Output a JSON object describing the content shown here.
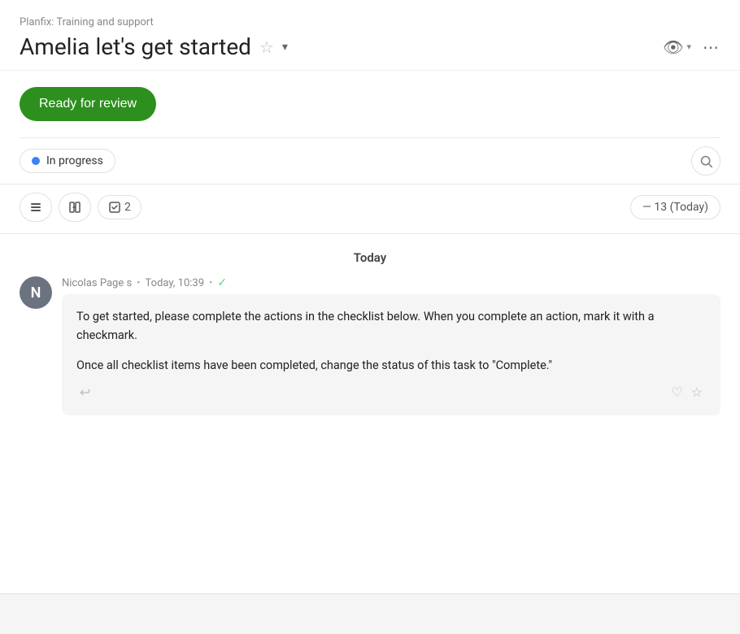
{
  "breadcrumb": "Planfix: Training and support",
  "title": "Amelia let's get started",
  "ready_button": "Ready for review",
  "status": {
    "label": "In progress",
    "dot_color": "#3b82f6"
  },
  "toolbar": {
    "checklist_count": "2",
    "date_info": "— 13 (Today)"
  },
  "feed": {
    "date_header": "Today",
    "messages": [
      {
        "sender": "Nicolas Page s",
        "time": "Today, 10:39",
        "avatar_letter": "N",
        "avatar_color": "#6b7280",
        "paragraphs": [
          "To get started, please complete the actions in the checklist below. When you complete an action, mark it with a checkmark.",
          "Once all checklist items have been completed, change the status of this task to \"Complete.\""
        ]
      }
    ]
  },
  "icons": {
    "star": "☆",
    "chevron_down": "▾",
    "eye": "◎",
    "more": "•••",
    "search": "○",
    "lines": "≡",
    "columns": "⊞",
    "check": "☑",
    "reply": "↩",
    "heart": "♡",
    "star_outline": "☆",
    "verified": "✓"
  }
}
